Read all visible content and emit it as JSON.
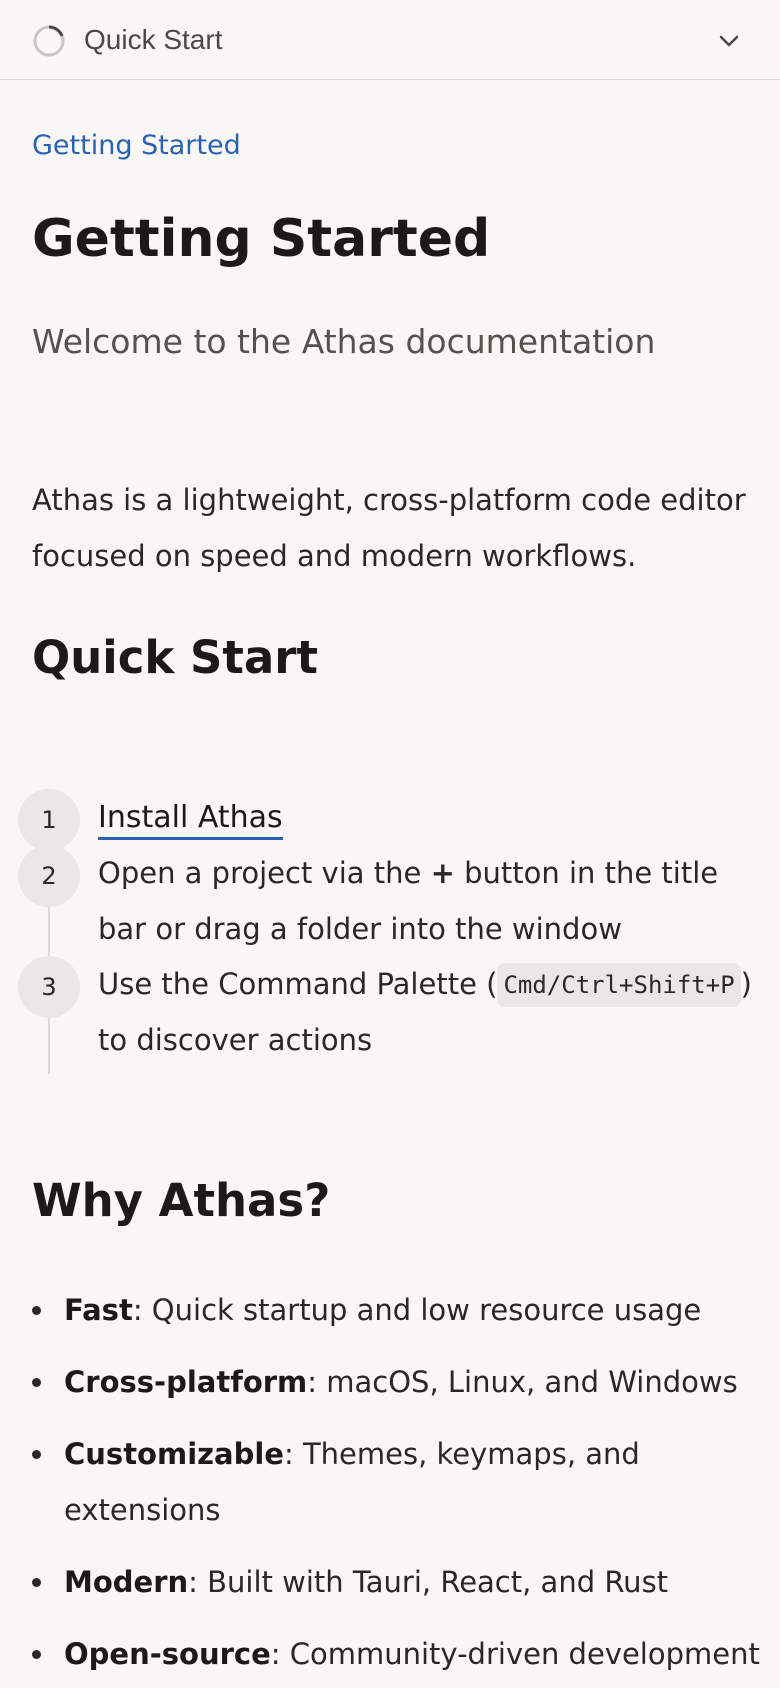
{
  "topbar": {
    "title": "Quick Start"
  },
  "breadcrumb": "Getting Started",
  "page": {
    "title": "Getting Started",
    "subtitle": "Welcome to the Athas documentation",
    "intro": "Athas is a lightweight, cross-platform code editor focused on speed and modern workflows."
  },
  "quick_start": {
    "heading": "Quick Start",
    "steps": [
      {
        "number": "1",
        "link": "Install Athas"
      },
      {
        "number": "2",
        "before": "Open a project via the ",
        "plus": "+",
        "after": " button in the title bar or drag a folder into the window"
      },
      {
        "number": "3",
        "before": "Use the Command Palette (",
        "kbd": "Cmd/Ctrl+Shift+P",
        "after": ") to discover actions"
      }
    ]
  },
  "why": {
    "heading": "Why Athas?",
    "items": [
      {
        "term": "Fast",
        "text": ": Quick startup and low resource usage"
      },
      {
        "term": "Cross-platform",
        "text": ": macOS, Linux, and Windows"
      },
      {
        "term": "Customizable",
        "text": ": Themes, keymaps, and extensions"
      },
      {
        "term": "Modern",
        "text": ": Built with Tauri, React, and Rust"
      },
      {
        "term": "Open-source",
        "text": ": Community-driven development"
      }
    ]
  },
  "colors": {
    "link": "#2b62b0",
    "background": "#f8f7f5",
    "text": "#1c1a17"
  },
  "icons": {
    "progress": "progress-ring-icon",
    "toggle": "chevron-down-icon"
  }
}
